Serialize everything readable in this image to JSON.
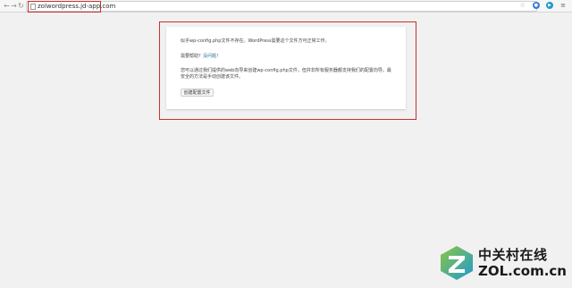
{
  "browser": {
    "url": "zolwordpress.jd-app.com",
    "back_icon": "back-arrow-icon",
    "forward_icon": "forward-arrow-icon",
    "reload_icon": "reload-icon",
    "bookmark_icon": "star-icon",
    "menu_icon": "hamburger-menu-icon",
    "accent_color": "#c9302c"
  },
  "dialog": {
    "line1": "似乎wp-config.php文件不存在。WordPress需要这个文件方可正常工作。",
    "help_prefix": "需要帮助？",
    "help_link": "没问题",
    "help_suffix": "！",
    "line3": "您可以通过我们提供的web向导来创建wp-config.php文件，但并非所有服务器都支持我们的配置向导。最安全的方法是手动创建该文件。",
    "button_label": "创建配置文件"
  },
  "watermark": {
    "text_cn": "中关村在线",
    "text_en": "ZOL.com.cn"
  }
}
